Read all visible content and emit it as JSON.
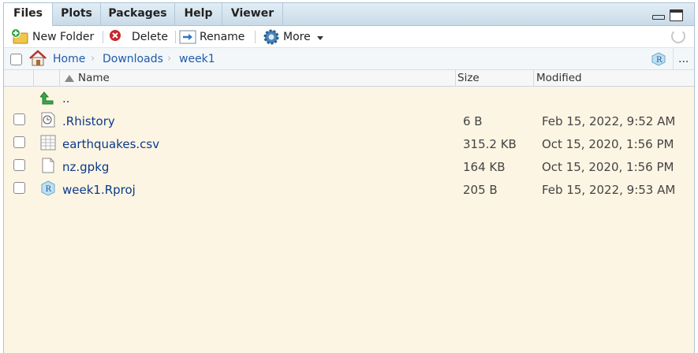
{
  "tabs": [
    {
      "label": "Files",
      "active": true
    },
    {
      "label": "Plots",
      "active": false
    },
    {
      "label": "Packages",
      "active": false
    },
    {
      "label": "Help",
      "active": false
    },
    {
      "label": "Viewer",
      "active": false
    }
  ],
  "toolbar": {
    "new_folder": "New Folder",
    "delete": "Delete",
    "rename": "Rename",
    "more": "More"
  },
  "breadcrumb": {
    "items": [
      "Home",
      "Downloads",
      "week1"
    ],
    "more": "..."
  },
  "columns": {
    "name": "Name",
    "size": "Size",
    "modified": "Modified"
  },
  "parent_dir": "..",
  "files": [
    {
      "name": ".Rhistory",
      "size": "6 B",
      "modified": "Feb 15, 2022, 9:52 AM",
      "icon": "history-file-icon"
    },
    {
      "name": "earthquakes.csv",
      "size": "315.2 KB",
      "modified": "Oct 15, 2020, 1:56 PM",
      "icon": "csv-file-icon"
    },
    {
      "name": "nz.gpkg",
      "size": "164 KB",
      "modified": "Oct 15, 2020, 1:56 PM",
      "icon": "blank-file-icon"
    },
    {
      "name": "week1.Rproj",
      "size": "205 B",
      "modified": "Feb 15, 2022, 9:53 AM",
      "icon": "rproj-file-icon"
    }
  ],
  "colors": {
    "link": "#0a3a8c",
    "background": "#fdf5e3",
    "tab_bar": "#c9dbe8"
  }
}
